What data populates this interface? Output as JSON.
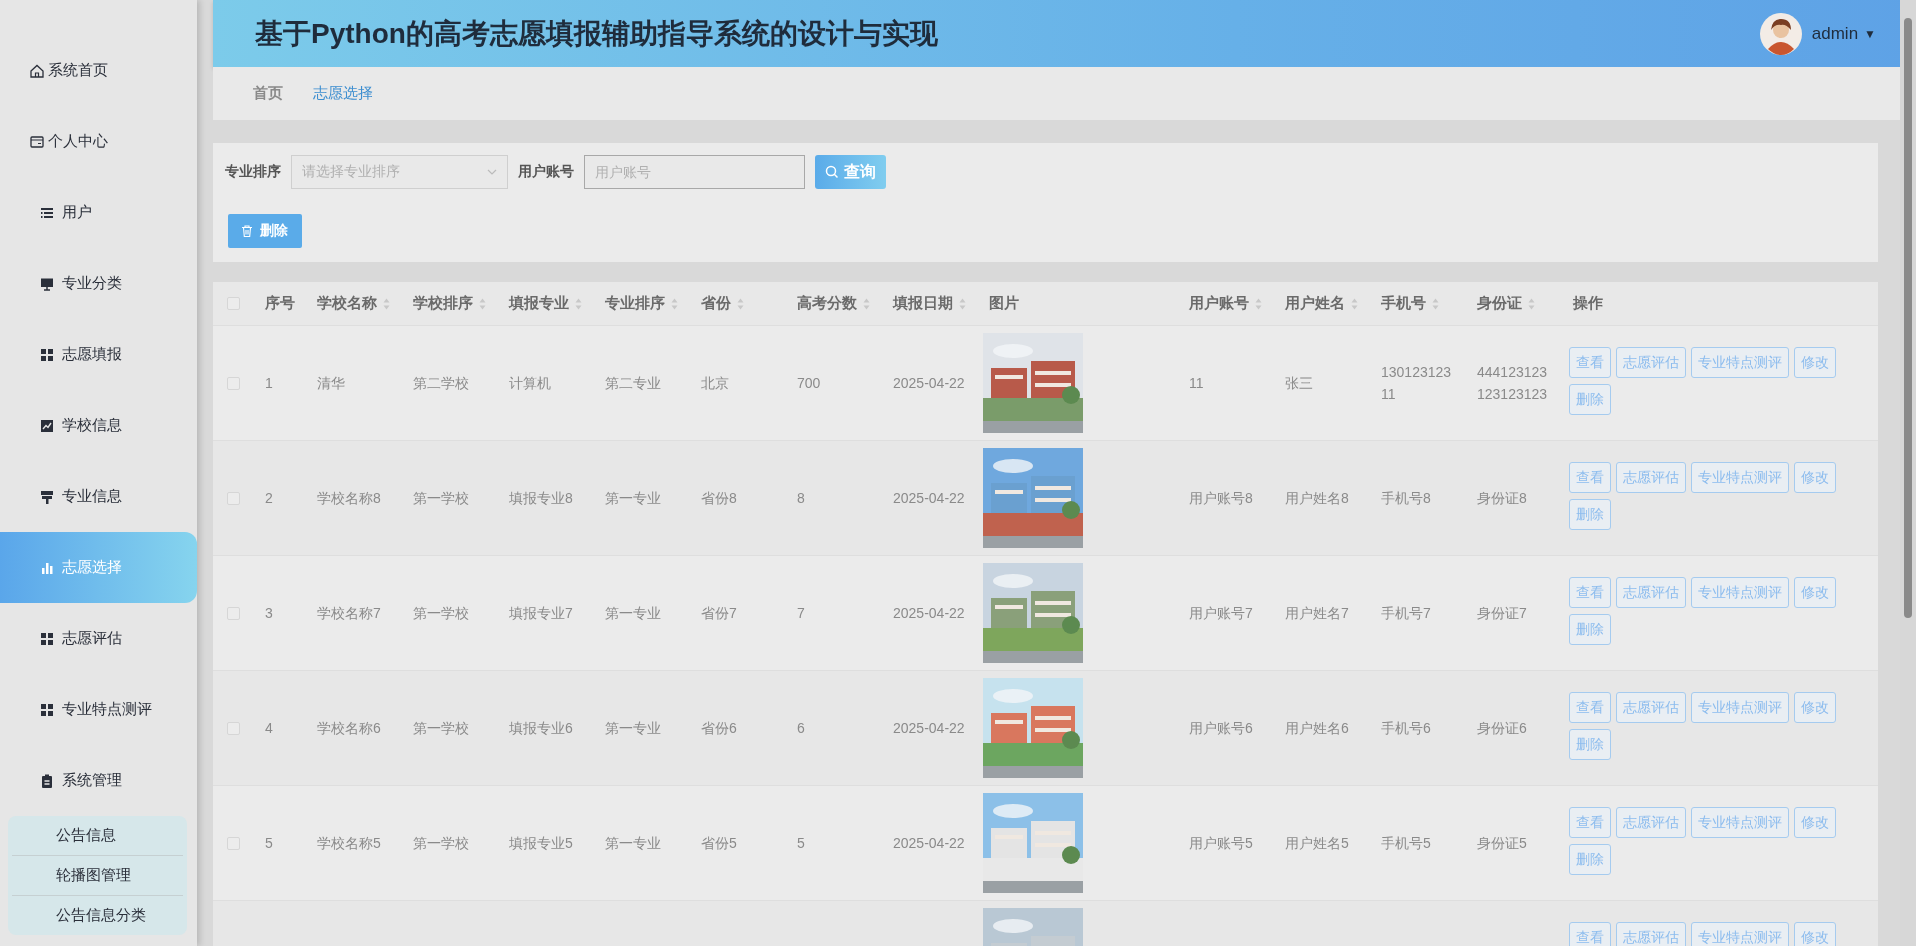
{
  "header": {
    "title": "基于Python的高考志愿填报辅助指导系统的设计与实现",
    "user": "admin",
    "caret": "▼"
  },
  "sidebar": {
    "items": [
      {
        "label": "系统首页",
        "selected": false
      },
      {
        "label": "个人中心",
        "selected": false
      },
      {
        "label": "用户",
        "selected": false
      },
      {
        "label": "专业分类",
        "selected": false
      },
      {
        "label": "志愿填报",
        "selected": false
      },
      {
        "label": "学校信息",
        "selected": false
      },
      {
        "label": "专业信息",
        "selected": false
      },
      {
        "label": "志愿选择",
        "selected": true
      },
      {
        "label": "志愿评估",
        "selected": false
      },
      {
        "label": "专业特点测评",
        "selected": false
      },
      {
        "label": "系统管理",
        "selected": false,
        "expanded": true,
        "children": [
          {
            "label": "公告信息"
          },
          {
            "label": "轮播图管理"
          },
          {
            "label": "公告信息分类"
          }
        ]
      }
    ]
  },
  "breadcrumb": [
    {
      "label": "首页",
      "current": false
    },
    {
      "label": "志愿选择",
      "current": true
    }
  ],
  "search": {
    "fields": [
      {
        "label": "专业排序",
        "kind": "select",
        "placeholder": "请选择专业排序"
      },
      {
        "label": "用户账号",
        "kind": "input",
        "placeholder": "用户账号"
      }
    ],
    "query_button": "查询",
    "delete_button": "删除"
  },
  "table": {
    "select_all": false,
    "columns": [
      {
        "label": "序号",
        "kind": "text",
        "sortable": false
      },
      {
        "label": "学校名称",
        "kind": "text",
        "sortable": true
      },
      {
        "label": "学校排序",
        "kind": "text",
        "sortable": true
      },
      {
        "label": "填报专业",
        "kind": "text",
        "sortable": true
      },
      {
        "label": "专业排序",
        "kind": "text",
        "sortable": true
      },
      {
        "label": "省份",
        "kind": "text",
        "sortable": true
      },
      {
        "label": "高考分数",
        "kind": "text",
        "sortable": true
      },
      {
        "label": "填报日期",
        "kind": "text",
        "sortable": true
      },
      {
        "label": "图片",
        "kind": "picture",
        "sortable": false
      },
      {
        "label": "用户账号",
        "kind": "text",
        "sortable": true
      },
      {
        "label": "用户姓名",
        "kind": "text",
        "sortable": true
      },
      {
        "label": "手机号",
        "kind": "text",
        "sortable": true
      },
      {
        "label": "身份证",
        "kind": "text",
        "sortable": true
      },
      {
        "label": "操作",
        "kind": "actions",
        "sortable": false
      }
    ],
    "rows": [
      {
        "checked": false,
        "cells": [
          "1",
          "清华",
          "第二学校",
          "计算机",
          "第二专业",
          "北京",
          "700",
          "2025-04-22",
          "11",
          "张三",
          "13012312311",
          "444123123123123123"
        ],
        "actions": [
          "查看",
          "志愿评估",
          "专业特点测评",
          "修改",
          "删除"
        ]
      },
      {
        "checked": false,
        "cells": [
          "2",
          "学校名称8",
          "第一学校",
          "填报专业8",
          "第一专业",
          "省份8",
          "8",
          "2025-04-22",
          "用户账号8",
          "用户姓名8",
          "手机号8",
          "身份证8"
        ],
        "actions": [
          "查看",
          "志愿评估",
          "专业特点测评",
          "修改",
          "删除"
        ]
      },
      {
        "checked": false,
        "cells": [
          "3",
          "学校名称7",
          "第一学校",
          "填报专业7",
          "第一专业",
          "省份7",
          "7",
          "2025-04-22",
          "用户账号7",
          "用户姓名7",
          "手机号7",
          "身份证7"
        ],
        "actions": [
          "查看",
          "志愿评估",
          "专业特点测评",
          "修改",
          "删除"
        ]
      },
      {
        "checked": false,
        "cells": [
          "4",
          "学校名称6",
          "第一学校",
          "填报专业6",
          "第一专业",
          "省份6",
          "6",
          "2025-04-22",
          "用户账号6",
          "用户姓名6",
          "手机号6",
          "身份证6"
        ],
        "actions": [
          "查看",
          "志愿评估",
          "专业特点测评",
          "修改",
          "删除"
        ]
      },
      {
        "checked": false,
        "cells": [
          "5",
          "学校名称5",
          "第一学校",
          "填报专业5",
          "第一专业",
          "省份5",
          "5",
          "2025-04-22",
          "用户账号5",
          "用户姓名5",
          "手机号5",
          "身份证5"
        ],
        "actions": [
          "查看",
          "志愿评估",
          "专业特点测评",
          "修改",
          "删除"
        ]
      },
      {
        "actions": [
          "查看",
          "志愿评估",
          "专业特点测评",
          "修改"
        ]
      }
    ]
  }
}
